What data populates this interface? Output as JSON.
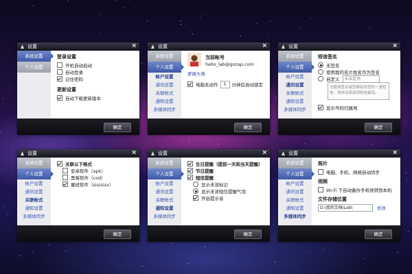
{
  "colors": {
    "accent": "#3f5aa8",
    "link": "#3b57b4",
    "footer": "#111116"
  },
  "window_title": "设置",
  "ok_label": "确定",
  "sidebar": {
    "system": "系统设置",
    "personal": "个人设置",
    "account": "帐户设置",
    "comm": "通讯设置",
    "relation": "关联帐式",
    "notify": "通知设置",
    "sync": "多媒体同步"
  },
  "w1": {
    "login_title": "登录设置",
    "login_items": [
      "开机自动启动",
      "自动登录",
      "记住密码"
    ],
    "update_title": "更新设置",
    "update_item": "自动下载更新版本"
  },
  "w2": {
    "account_label": "当前帐号",
    "email": "hello_lab@gozap.com",
    "change_avatar": "更换头像",
    "idle_prefix": "电脑无动作",
    "idle_minutes": "5",
    "idle_suffix": "分钟后自动锁定"
  },
  "w3": {
    "sig_title": "短信签名",
    "opt_none": "无签名",
    "opt_card": "使用我的名片姓名作为签名",
    "opt_custom": "自定义",
    "custom_placeholder": "未自定名",
    "textarea_hint": "当使用签名或您拥有时您的一张短信，将自动添加到短信最后。",
    "show_phone": "显示号码归属地"
  },
  "w4": {
    "assoc_title": "关联以下格式",
    "items": [
      "安卓软件（apk）",
      "黑莓软件（cod）",
      "塞班软件（sis/sisx）"
    ]
  },
  "w5": {
    "birthday": "生日提醒（提前一天和当天提醒）",
    "festival": "节日提醒",
    "sms_remind": "短信提醒",
    "opt_mark": "显示未读标记",
    "opt_popup": "显示未读短信提醒气泡",
    "opt_sound": "开启提示音"
  },
  "w6": {
    "photo_title": "照片",
    "photo_item": "电脑、手机、网络自动同步",
    "video_title": "视频",
    "video_item": "Wi-Fi 下自动备份手机视频到本机",
    "folder_title": "文件存储位置",
    "folder_path": "D:\\我的文档\\Lab\\",
    "modify": "修改"
  }
}
